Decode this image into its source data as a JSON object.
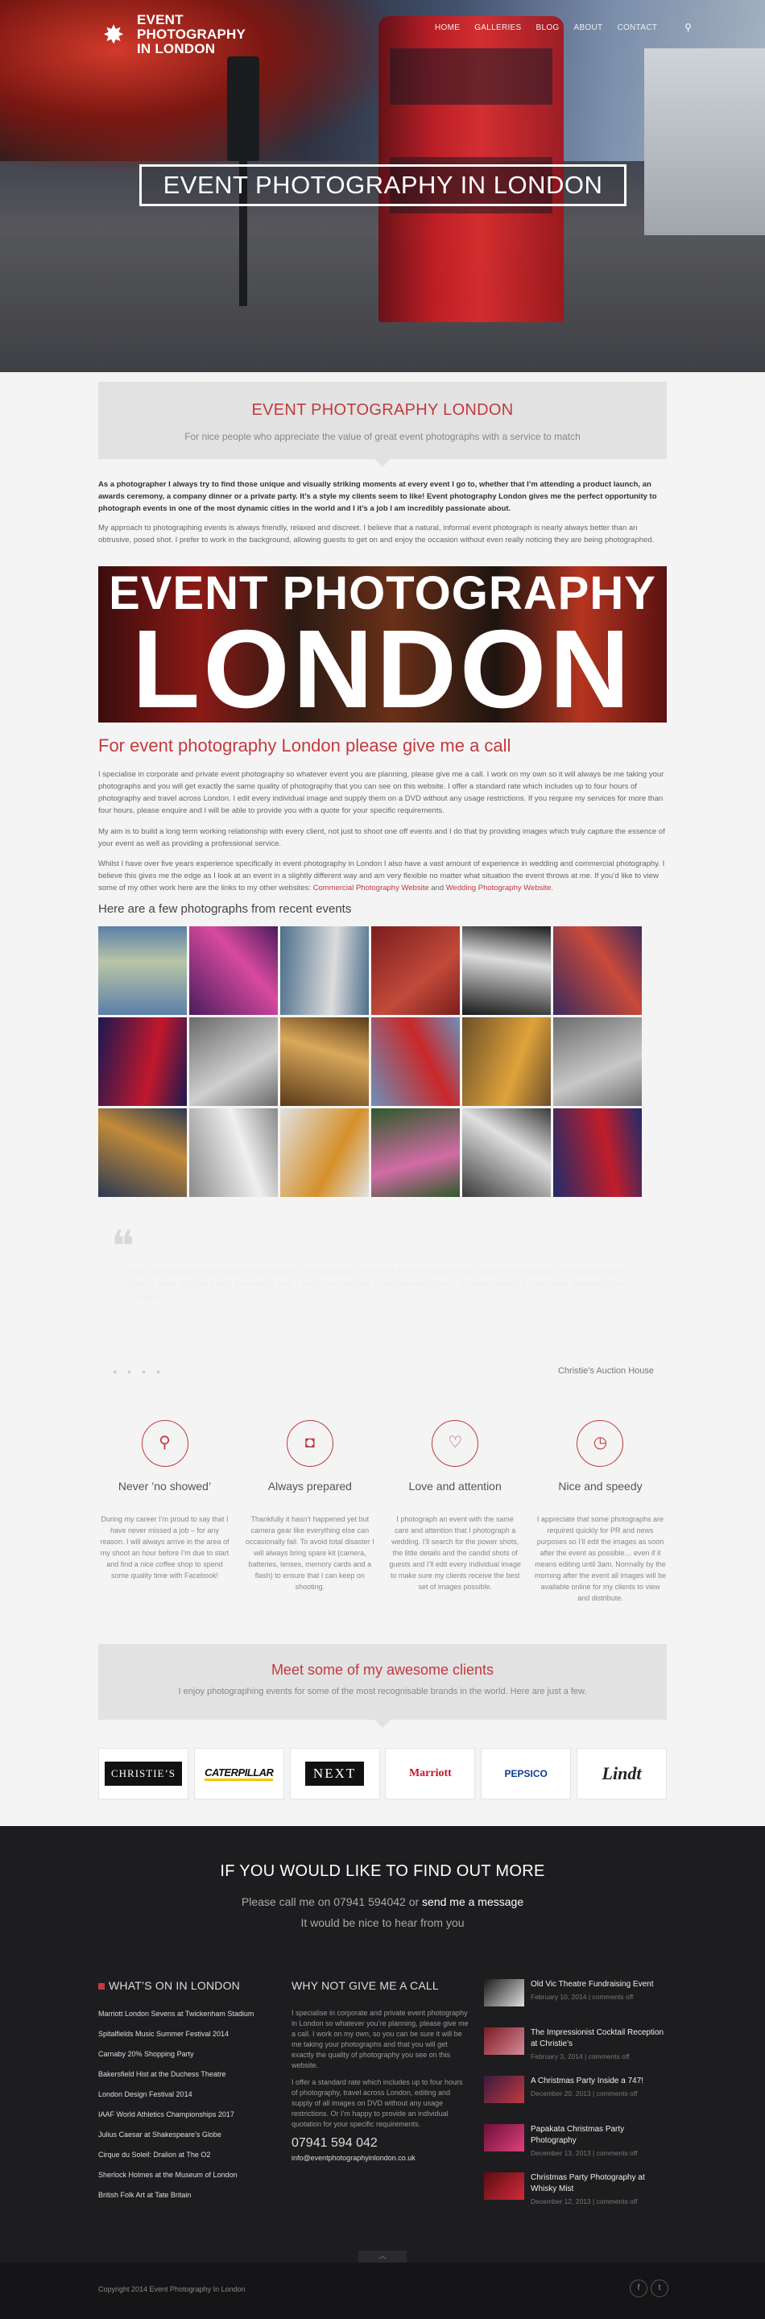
{
  "header": {
    "logo_line1": "EVENT PHOTOGRAPHY",
    "logo_line2": "IN LONDON",
    "nav": [
      "HOME",
      "GALLERIES",
      "BLOG",
      "ABOUT",
      "CONTACT"
    ],
    "hero_title": "EVENT PHOTOGRAPHY IN LONDON"
  },
  "intro": {
    "title": "EVENT PHOTOGRAPHY LONDON",
    "subtitle": "For nice people who appreciate the value of great event photographs with a service to match",
    "bold_paragraph": "As a photographer I always try to find those unique and visually striking moments at every event I go to, whether that I’m attending a product launch, an awards ceremony, a company dinner or a private party.  It’s a style my clients seem to like!  Event photography London gives me the perfect opportunity to photograph events in one of the most dynamic cities in the world and I it’s a job I am incredibly passionate about.",
    "paragraph": "My approach to photographing events is always friendly, relaxed and discreet.  I believe that a natural, informal event photograph is nearly always better than an obtrusive, posed shot.  I prefer to work in the background, allowing guests to get on and enjoy the occasion without even really noticing they are being photographed."
  },
  "banner": {
    "line1": "EVENT PHOTOGRAPHY",
    "line2": "LONDON"
  },
  "call": {
    "title": "For event photography London please give me a call",
    "p1": "I specialise in corporate and private event photography so whatever event you are planning, please give me a call.  I work on my own so it will always be me taking your photographs and you will get exactly the same quality of photography that you can see on this website.  I offer a standard rate which includes up to four hours of photography and travel across London.  I edit every individual image and supply them on a DVD without any usage restrictions.  If you require my services for more than four hours, please enquire and I will be able to provide you with a quote for your specific requirements.",
    "p2": "My aim is to build a long term working relationship with every client, not just to shoot one off events and I do that by providing images which truly capture the essence of your event as well as providing a professional service.",
    "p3": "Whilst I have over five years experience specifically in event photography in London I also have a vast amount of experience in wedding and commercial photography.  I believe this gives me the edge as I look at an event in a slightly different way and am very flexible no matter what situation the event throws at me.  If you’d like to view some of my other work here are the links to my other websites: ",
    "link1": "Commercial Photography Website",
    "and": " and ",
    "link2": "Wedding Photography Website",
    "end": "."
  },
  "recent_title": "Here are a few photographs from recent events",
  "gallery_colors": [
    [
      "#5b7fa8",
      "#b9c6a6"
    ],
    [
      "#4a1d5c",
      "#d84aa0"
    ],
    [
      "#4d6f8c",
      "#dcdcdc"
    ],
    [
      "#7a1e1e",
      "#c24a3a"
    ],
    [
      "#1a1a1a",
      "#dcdcdc"
    ],
    [
      "#3c2a5c",
      "#c94a3b"
    ],
    [
      "#1d1850",
      "#c2182c"
    ],
    [
      "#6a6a6a",
      "#cfcfcf"
    ],
    [
      "#5b3a1a",
      "#d9a85a"
    ],
    [
      "#6f8fb8",
      "#c9282a"
    ],
    [
      "#6b4f2a",
      "#e0a33a"
    ],
    [
      "#6c6c6c",
      "#c8c8c8"
    ],
    [
      "#2b3a52",
      "#c28a3a"
    ],
    [
      "#8a8a8a",
      "#f0f0f0"
    ],
    [
      "#e1e1e1",
      "#d5902a"
    ],
    [
      "#2f5a2a",
      "#d16ca6"
    ],
    [
      "#3a3a3a",
      "#e0e0e0"
    ],
    [
      "#1f2c6a",
      "#c11d2a"
    ]
  ],
  "testimonial": {
    "text": "Neil’s photography was quite simply superb. He captured the feel of the evening and was discreet throughout. Our guests and clients were delighted with the results and I would not hesitate to recommend him to anyone looking for an event photographer in London.",
    "author": "Christie’s Auction House"
  },
  "features": [
    {
      "icon": "location-pin-icon",
      "glyph": "⚲",
      "title": "Never ’no showed’",
      "text": "During my career I’m proud to say that I have never missed a job – for any reason. I will always arrive in the area of my shoot an hour before I’m due to start and find a nice coffee shop to spend some quality time with Facebook!"
    },
    {
      "icon": "camera-icon",
      "glyph": "◘",
      "title": "Always prepared",
      "text": "Thankfully it hasn’t happened yet but camera gear like everything else can occasionally fail. To avoid total disaster I will always bring spare kit (camera, batteries, lenses, memory cards and a flash) to ensure that I can keep on shooting."
    },
    {
      "icon": "heart-icon",
      "glyph": "♡",
      "title": "Love and attention",
      "text": "I photograph an event with the same care and attention that I photograph a wedding. I’ll search for the power shots, the little details and the candid shots of guests and I’ll edit every individual image to make sure my clients receive the best set of images possible."
    },
    {
      "icon": "clock-icon",
      "glyph": "◷",
      "title": "Nice and speedy",
      "text": "I appreciate that some photographs are required quickly for PR and news purposes so I’ll edit the images as soon after the event as possible… even if it means editing until 3am. Normally by the morning after the event all images will be available online for my clients to view and distribute."
    }
  ],
  "clients": {
    "title": "Meet some of my awesome clients",
    "subtitle": "I enjoy photographing events for some of the most recognisable brands in the world. Here are just a few.",
    "logos": [
      "CHRISTIE’S",
      "CATERPILLAR",
      "NEXT",
      "Marriott",
      "PEPSICO",
      "Lindt"
    ]
  },
  "cta": {
    "title": "IF YOU WOULD LIKE TO FIND OUT MORE",
    "line1_pre": "Please call me on 07941 594042 or ",
    "line1_link": "send me a message",
    "line2": "It would be nice to hear from you"
  },
  "whats_on": {
    "title": "WHAT’S ON IN LONDON",
    "items": [
      "Marriott London Sevens at Twickenham Stadium",
      "Spitalfields Music Summer Festival 2014",
      "Carnaby 20% Shopping Party",
      "Bakersfield Hist at the Duchess Theatre",
      "London Design Festival 2014",
      "IAAF World Athletics Championships 2017",
      "Julius Caesar at Shakespeare’s Globe",
      "Cirque du Soleil: Dralion at The O2",
      "Sherlock Holmes at the Museum of London",
      "British Folk Art at Tate Britain"
    ]
  },
  "why_call": {
    "title": "WHY NOT GIVE ME A CALL",
    "p1": "I specialise in corporate and private event photography in London so whatever you’re planning, please give me a call. I work on my own, so you can be sure it will be me taking your photographs and that you will get exactly the quality of photography you see on this website.",
    "p2": "I offer a standard rate which includes up to four hours of photography, travel across London, editing and supply of all images on DVD without any usage restrictions. Or I’m happy to provide an individual quotation for your specific requirements.",
    "phone": "07941 594 042",
    "email": "info@eventphotographyinlondon.co.uk"
  },
  "posts": [
    {
      "title": "Old Vic Theatre Fundraising Event",
      "date": "February 10, 2014",
      "comments": "comments off",
      "c1": "#1a1a1a",
      "c2": "#e0e0e0"
    },
    {
      "title": "The Impressionist Cocktail Reception at Christie’s",
      "date": "February 3, 2014",
      "comments": "comments off",
      "c1": "#7a1a22",
      "c2": "#d88a9a"
    },
    {
      "title": "A Christmas Party Inside a 747!",
      "date": "December 20, 2013",
      "comments": "comments off",
      "c1": "#3a1a40",
      "c2": "#c23a3f"
    },
    {
      "title": "Papakata Christmas Party Photography",
      "date": "December 13, 2013",
      "comments": "comments off",
      "c1": "#6a0f3a",
      "c2": "#e0407a"
    },
    {
      "title": "Christmas Party Photography at Whisky Mist",
      "date": "December 12, 2013",
      "comments": "comments off",
      "c1": "#5a0d12",
      "c2": "#d42a3a"
    }
  ],
  "footer": {
    "copyright": "Copyright 2014 Event Photography In London",
    "social": [
      "f",
      "t"
    ]
  }
}
